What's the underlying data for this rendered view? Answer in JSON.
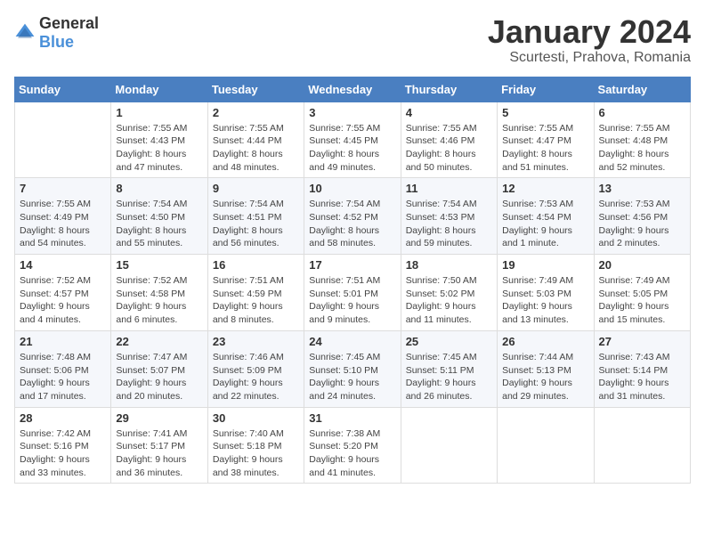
{
  "logo": {
    "general": "General",
    "blue": "Blue"
  },
  "title": "January 2024",
  "location": "Scurtesti, Prahova, Romania",
  "weekdays": [
    "Sunday",
    "Monday",
    "Tuesday",
    "Wednesday",
    "Thursday",
    "Friday",
    "Saturday"
  ],
  "weeks": [
    [
      {
        "day": "",
        "sunrise": "",
        "sunset": "",
        "daylight": ""
      },
      {
        "day": "1",
        "sunrise": "Sunrise: 7:55 AM",
        "sunset": "Sunset: 4:43 PM",
        "daylight": "Daylight: 8 hours and 47 minutes."
      },
      {
        "day": "2",
        "sunrise": "Sunrise: 7:55 AM",
        "sunset": "Sunset: 4:44 PM",
        "daylight": "Daylight: 8 hours and 48 minutes."
      },
      {
        "day": "3",
        "sunrise": "Sunrise: 7:55 AM",
        "sunset": "Sunset: 4:45 PM",
        "daylight": "Daylight: 8 hours and 49 minutes."
      },
      {
        "day": "4",
        "sunrise": "Sunrise: 7:55 AM",
        "sunset": "Sunset: 4:46 PM",
        "daylight": "Daylight: 8 hours and 50 minutes."
      },
      {
        "day": "5",
        "sunrise": "Sunrise: 7:55 AM",
        "sunset": "Sunset: 4:47 PM",
        "daylight": "Daylight: 8 hours and 51 minutes."
      },
      {
        "day": "6",
        "sunrise": "Sunrise: 7:55 AM",
        "sunset": "Sunset: 4:48 PM",
        "daylight": "Daylight: 8 hours and 52 minutes."
      }
    ],
    [
      {
        "day": "7",
        "sunrise": "Sunrise: 7:55 AM",
        "sunset": "Sunset: 4:49 PM",
        "daylight": "Daylight: 8 hours and 54 minutes."
      },
      {
        "day": "8",
        "sunrise": "Sunrise: 7:54 AM",
        "sunset": "Sunset: 4:50 PM",
        "daylight": "Daylight: 8 hours and 55 minutes."
      },
      {
        "day": "9",
        "sunrise": "Sunrise: 7:54 AM",
        "sunset": "Sunset: 4:51 PM",
        "daylight": "Daylight: 8 hours and 56 minutes."
      },
      {
        "day": "10",
        "sunrise": "Sunrise: 7:54 AM",
        "sunset": "Sunset: 4:52 PM",
        "daylight": "Daylight: 8 hours and 58 minutes."
      },
      {
        "day": "11",
        "sunrise": "Sunrise: 7:54 AM",
        "sunset": "Sunset: 4:53 PM",
        "daylight": "Daylight: 8 hours and 59 minutes."
      },
      {
        "day": "12",
        "sunrise": "Sunrise: 7:53 AM",
        "sunset": "Sunset: 4:54 PM",
        "daylight": "Daylight: 9 hours and 1 minute."
      },
      {
        "day": "13",
        "sunrise": "Sunrise: 7:53 AM",
        "sunset": "Sunset: 4:56 PM",
        "daylight": "Daylight: 9 hours and 2 minutes."
      }
    ],
    [
      {
        "day": "14",
        "sunrise": "Sunrise: 7:52 AM",
        "sunset": "Sunset: 4:57 PM",
        "daylight": "Daylight: 9 hours and 4 minutes."
      },
      {
        "day": "15",
        "sunrise": "Sunrise: 7:52 AM",
        "sunset": "Sunset: 4:58 PM",
        "daylight": "Daylight: 9 hours and 6 minutes."
      },
      {
        "day": "16",
        "sunrise": "Sunrise: 7:51 AM",
        "sunset": "Sunset: 4:59 PM",
        "daylight": "Daylight: 9 hours and 8 minutes."
      },
      {
        "day": "17",
        "sunrise": "Sunrise: 7:51 AM",
        "sunset": "Sunset: 5:01 PM",
        "daylight": "Daylight: 9 hours and 9 minutes."
      },
      {
        "day": "18",
        "sunrise": "Sunrise: 7:50 AM",
        "sunset": "Sunset: 5:02 PM",
        "daylight": "Daylight: 9 hours and 11 minutes."
      },
      {
        "day": "19",
        "sunrise": "Sunrise: 7:49 AM",
        "sunset": "Sunset: 5:03 PM",
        "daylight": "Daylight: 9 hours and 13 minutes."
      },
      {
        "day": "20",
        "sunrise": "Sunrise: 7:49 AM",
        "sunset": "Sunset: 5:05 PM",
        "daylight": "Daylight: 9 hours and 15 minutes."
      }
    ],
    [
      {
        "day": "21",
        "sunrise": "Sunrise: 7:48 AM",
        "sunset": "Sunset: 5:06 PM",
        "daylight": "Daylight: 9 hours and 17 minutes."
      },
      {
        "day": "22",
        "sunrise": "Sunrise: 7:47 AM",
        "sunset": "Sunset: 5:07 PM",
        "daylight": "Daylight: 9 hours and 20 minutes."
      },
      {
        "day": "23",
        "sunrise": "Sunrise: 7:46 AM",
        "sunset": "Sunset: 5:09 PM",
        "daylight": "Daylight: 9 hours and 22 minutes."
      },
      {
        "day": "24",
        "sunrise": "Sunrise: 7:45 AM",
        "sunset": "Sunset: 5:10 PM",
        "daylight": "Daylight: 9 hours and 24 minutes."
      },
      {
        "day": "25",
        "sunrise": "Sunrise: 7:45 AM",
        "sunset": "Sunset: 5:11 PM",
        "daylight": "Daylight: 9 hours and 26 minutes."
      },
      {
        "day": "26",
        "sunrise": "Sunrise: 7:44 AM",
        "sunset": "Sunset: 5:13 PM",
        "daylight": "Daylight: 9 hours and 29 minutes."
      },
      {
        "day": "27",
        "sunrise": "Sunrise: 7:43 AM",
        "sunset": "Sunset: 5:14 PM",
        "daylight": "Daylight: 9 hours and 31 minutes."
      }
    ],
    [
      {
        "day": "28",
        "sunrise": "Sunrise: 7:42 AM",
        "sunset": "Sunset: 5:16 PM",
        "daylight": "Daylight: 9 hours and 33 minutes."
      },
      {
        "day": "29",
        "sunrise": "Sunrise: 7:41 AM",
        "sunset": "Sunset: 5:17 PM",
        "daylight": "Daylight: 9 hours and 36 minutes."
      },
      {
        "day": "30",
        "sunrise": "Sunrise: 7:40 AM",
        "sunset": "Sunset: 5:18 PM",
        "daylight": "Daylight: 9 hours and 38 minutes."
      },
      {
        "day": "31",
        "sunrise": "Sunrise: 7:38 AM",
        "sunset": "Sunset: 5:20 PM",
        "daylight": "Daylight: 9 hours and 41 minutes."
      },
      {
        "day": "",
        "sunrise": "",
        "sunset": "",
        "daylight": ""
      },
      {
        "day": "",
        "sunrise": "",
        "sunset": "",
        "daylight": ""
      },
      {
        "day": "",
        "sunrise": "",
        "sunset": "",
        "daylight": ""
      }
    ]
  ]
}
